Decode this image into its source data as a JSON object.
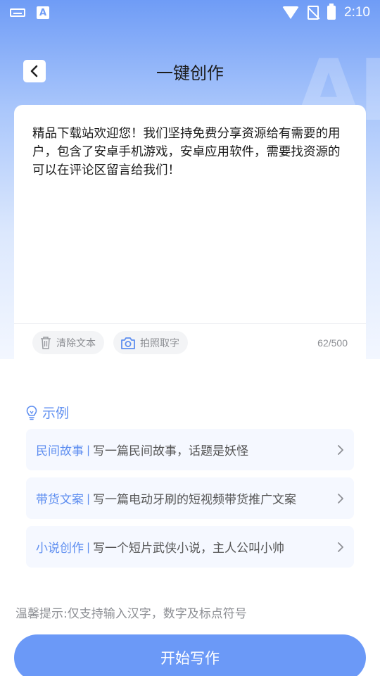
{
  "status_bar": {
    "time": "2:10",
    "left_icons": [
      "keyboard-icon",
      "a-app-icon"
    ],
    "right_icons": [
      "wifi-icon",
      "no-sim-icon",
      "battery-charging-icon"
    ]
  },
  "header": {
    "title": "一键创作",
    "back_icon": "chevron-left-icon"
  },
  "editor": {
    "text": "精品下载站欢迎您！我们坚持免费分享资源给有需要的用户，包含了安卓手机游戏，安卓应用软件，需要找资源的可以在评论区留言给我们！",
    "clear_label": "清除文本",
    "photo_label": "拍照取字",
    "counter": "62/500"
  },
  "examples": {
    "title": "示例",
    "items": [
      {
        "category": "民间故事",
        "separator": "|",
        "description": "写一篇民间故事，话题是妖怪"
      },
      {
        "category": "带货文案",
        "separator": "|",
        "description": "写一篇电动牙刷的短视频带货推广文案"
      },
      {
        "category": "小说创作",
        "separator": "|",
        "description": "写一个短片武侠小说，主人公叫小帅"
      }
    ]
  },
  "tip": "温馨提示:仅支持输入汉字，数字及标点符号",
  "start_button": "开始写作",
  "colors": {
    "accent": "#5e8ef0",
    "button": "#6b99f7",
    "header_gradient_top": "#6f9cf6"
  }
}
